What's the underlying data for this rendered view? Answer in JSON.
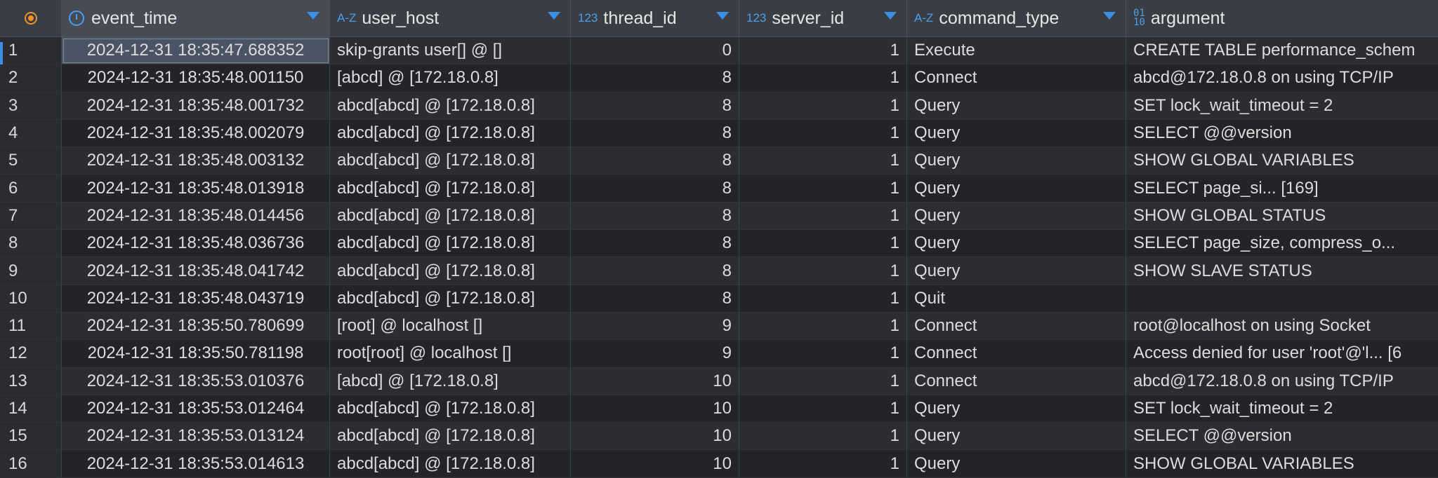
{
  "columns": [
    {
      "label": "event_time",
      "type_icon": "clock-icon"
    },
    {
      "label": "user_host",
      "type_icon": "A-Z"
    },
    {
      "label": "thread_id",
      "type_icon": "123"
    },
    {
      "label": "server_id",
      "type_icon": "123"
    },
    {
      "label": "command_type",
      "type_icon": "A-Z"
    },
    {
      "label": "argument",
      "type_icon": "binary-icon"
    }
  ],
  "rows": [
    {
      "n": "1",
      "event_time": "2024-12-31 18:35:47.688352",
      "user_host": "skip-grants user[] @  []",
      "thread_id": "0",
      "server_id": "1",
      "command_type": "Execute",
      "argument": "CREATE TABLE performance_schem"
    },
    {
      "n": "2",
      "event_time": "2024-12-31 18:35:48.001150",
      "user_host": "[abcd] @  [172.18.0.8]",
      "thread_id": "8",
      "server_id": "1",
      "command_type": "Connect",
      "argument": "abcd@172.18.0.8 on  using TCP/IP"
    },
    {
      "n": "3",
      "event_time": "2024-12-31 18:35:48.001732",
      "user_host": "abcd[abcd] @  [172.18.0.8]",
      "thread_id": "8",
      "server_id": "1",
      "command_type": "Query",
      "argument": "SET lock_wait_timeout = 2"
    },
    {
      "n": "4",
      "event_time": "2024-12-31 18:35:48.002079",
      "user_host": "abcd[abcd] @  [172.18.0.8]",
      "thread_id": "8",
      "server_id": "1",
      "command_type": "Query",
      "argument": "SELECT @@version"
    },
    {
      "n": "5",
      "event_time": "2024-12-31 18:35:48.003132",
      "user_host": "abcd[abcd] @  [172.18.0.8]",
      "thread_id": "8",
      "server_id": "1",
      "command_type": "Query",
      "argument": "SHOW GLOBAL VARIABLES"
    },
    {
      "n": "6",
      "event_time": "2024-12-31 18:35:48.013918",
      "user_host": "abcd[abcd] @  [172.18.0.8]",
      "thread_id": "8",
      "server_id": "1",
      "command_type": "Query",
      "argument": "SELECT                  page_si... [169]"
    },
    {
      "n": "7",
      "event_time": "2024-12-31 18:35:48.014456",
      "user_host": "abcd[abcd] @  [172.18.0.8]",
      "thread_id": "8",
      "server_id": "1",
      "command_type": "Query",
      "argument": "SHOW GLOBAL STATUS"
    },
    {
      "n": "8",
      "event_time": "2024-12-31 18:35:48.036736",
      "user_host": "abcd[abcd] @  [172.18.0.8]",
      "thread_id": "8",
      "server_id": "1",
      "command_type": "Query",
      "argument": "SELECT     page_size, compress_o..."
    },
    {
      "n": "9",
      "event_time": "2024-12-31 18:35:48.041742",
      "user_host": "abcd[abcd] @  [172.18.0.8]",
      "thread_id": "8",
      "server_id": "1",
      "command_type": "Query",
      "argument": "SHOW SLAVE STATUS"
    },
    {
      "n": "10",
      "event_time": "2024-12-31 18:35:48.043719",
      "user_host": "abcd[abcd] @  [172.18.0.8]",
      "thread_id": "8",
      "server_id": "1",
      "command_type": "Quit",
      "argument": ""
    },
    {
      "n": "11",
      "event_time": "2024-12-31 18:35:50.780699",
      "user_host": "[root] @ localhost []",
      "thread_id": "9",
      "server_id": "1",
      "command_type": "Connect",
      "argument": "root@localhost on  using Socket"
    },
    {
      "n": "12",
      "event_time": "2024-12-31 18:35:50.781198",
      "user_host": "root[root] @ localhost []",
      "thread_id": "9",
      "server_id": "1",
      "command_type": "Connect",
      "argument": "Access denied for user 'root'@'l... [6"
    },
    {
      "n": "13",
      "event_time": "2024-12-31 18:35:53.010376",
      "user_host": "[abcd] @  [172.18.0.8]",
      "thread_id": "10",
      "server_id": "1",
      "command_type": "Connect",
      "argument": "abcd@172.18.0.8 on  using TCP/IP"
    },
    {
      "n": "14",
      "event_time": "2024-12-31 18:35:53.012464",
      "user_host": "abcd[abcd] @  [172.18.0.8]",
      "thread_id": "10",
      "server_id": "1",
      "command_type": "Query",
      "argument": "SET lock_wait_timeout = 2"
    },
    {
      "n": "15",
      "event_time": "2024-12-31 18:35:53.013124",
      "user_host": "abcd[abcd] @  [172.18.0.8]",
      "thread_id": "10",
      "server_id": "1",
      "command_type": "Query",
      "argument": "SELECT @@version"
    },
    {
      "n": "16",
      "event_time": "2024-12-31 18:35:53.014613",
      "user_host": "abcd[abcd] @  [172.18.0.8]",
      "thread_id": "10",
      "server_id": "1",
      "command_type": "Query",
      "argument": "SHOW GLOBAL VARIABLES"
    }
  ]
}
